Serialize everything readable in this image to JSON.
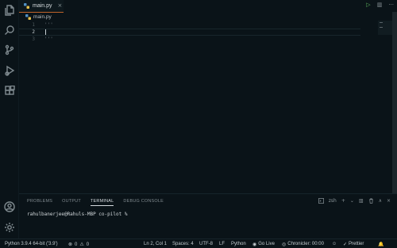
{
  "tabs": [
    {
      "label": "main.py",
      "close": "×"
    }
  ],
  "tab_actions": {
    "run": "▷",
    "split": "▥",
    "more": "···"
  },
  "breadcrumb": {
    "file": "main.py"
  },
  "editor": {
    "lines": [
      {
        "number": "1",
        "code": "'''"
      },
      {
        "number": "2",
        "code": ""
      },
      {
        "number": "3",
        "code": "'''"
      }
    ]
  },
  "panel": {
    "tabs": [
      "PROBLEMS",
      "OUTPUT",
      "TERMINAL",
      "DEBUG CONSOLE"
    ],
    "active_tab": "TERMINAL",
    "shell": "zsh",
    "actions": {
      "add": "+",
      "dropdown": "⌄",
      "split": "▥",
      "trash": "🗑",
      "maximize": "∧",
      "close": "×"
    },
    "terminal_text": "rahulbanerjee@Rahuls-MBP co-pilot % "
  },
  "statusbar": {
    "python": "Python 3.9.4 64-bit ('3.9')",
    "errors": "0",
    "warnings": "0",
    "position": "Ln 2, Col 1",
    "spaces": "Spaces: 4",
    "encoding": "UTF-8",
    "eol": "LF",
    "language": "Python",
    "golive": "Go Live",
    "chronicler": "Chronicler: 00:00",
    "prettier": "Prettier"
  },
  "colors": {
    "accent": "#c0642a",
    "run": "#5fb760",
    "background": "#0a1318"
  }
}
